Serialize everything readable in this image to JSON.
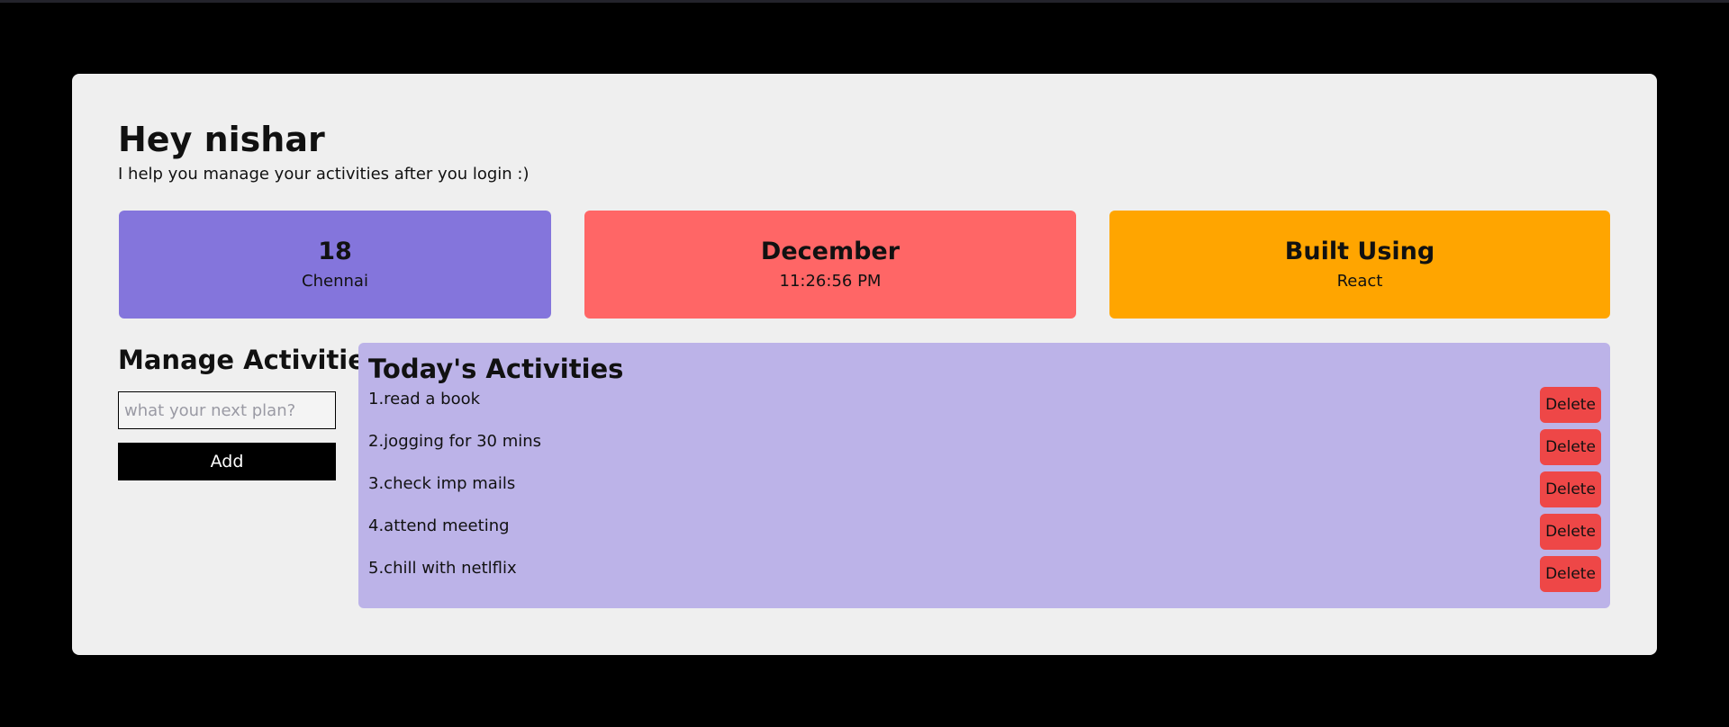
{
  "header": {
    "greeting": "Hey nishar",
    "subtitle": "I help you manage your activities after you login :)"
  },
  "stats": [
    {
      "main": "18",
      "sub": "Chennai",
      "color": "#8475dc"
    },
    {
      "main": "December",
      "sub": "11:26:56 PM",
      "color": "#ff6666"
    },
    {
      "main": "Built Using",
      "sub": "React",
      "color": "#ffa500"
    }
  ],
  "manage": {
    "title": "Manage Activities",
    "input_placeholder": "what your next plan?",
    "input_value": "",
    "add_label": "Add"
  },
  "activities": {
    "title": "Today's Activities",
    "delete_label": "Delete",
    "items": [
      {
        "label": "1.read a book"
      },
      {
        "label": "2.jogging for 30 mins"
      },
      {
        "label": "3.check imp mails"
      },
      {
        "label": "4.attend meeting"
      },
      {
        "label": "5.chill with netlflix"
      }
    ]
  },
  "colors": {
    "page_background": "#000000",
    "card_background": "#efefef",
    "activities_panel": "#bcb3e8",
    "delete_button": "#ee4747",
    "add_button": "#000000"
  }
}
